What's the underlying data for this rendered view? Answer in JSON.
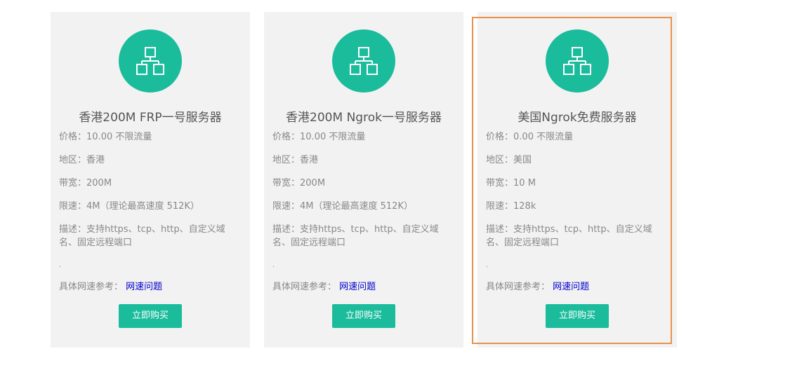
{
  "colors": {
    "accent": "#1abc9c",
    "highlight_border": "#e8914a",
    "card_bg": "#f2f2f2",
    "link": "#0000cc"
  },
  "icon": "network-topology-icon",
  "cards": [
    {
      "title": "香港200M FRP一号服务器",
      "price_label": "价格：",
      "price": "10.00 不限流量",
      "region_label": "地区：",
      "region": "香港",
      "bandwidth_label": "带宽：",
      "bandwidth": "200M",
      "speed_limit_label": "限速：",
      "speed_limit": "4M（理论最高速度 512K）",
      "description_label": "描述：",
      "description": "支持https、tcp、http、自定义域名、固定远程端口",
      "dot": "·",
      "reference_label": "具体网速参考：",
      "reference_link": "网速问题",
      "buy_label": "立即购买"
    },
    {
      "title": "香港200M Ngrok一号服务器",
      "price_label": "价格：",
      "price": "10.00 不限流量",
      "region_label": "地区：",
      "region": "香港",
      "bandwidth_label": "带宽：",
      "bandwidth": "200M",
      "speed_limit_label": "限速：",
      "speed_limit": "4M（理论最高速度 512K）",
      "description_label": "描述：",
      "description": "支持https、tcp、http、自定义域名、固定远程端口",
      "dot": "·",
      "reference_label": "具体网速参考：",
      "reference_link": "网速问题",
      "buy_label": "立即购买"
    },
    {
      "title": "美国Ngrok免费服务器",
      "price_label": "价格：",
      "price": "0.00 不限流量",
      "region_label": "地区：",
      "region": "美国",
      "bandwidth_label": "带宽：",
      "bandwidth": "10 M",
      "speed_limit_label": "限速：",
      "speed_limit": "128k",
      "description_label": "描述：",
      "description": "支持https、tcp、http、自定义域名、固定远程端口",
      "dot": "·",
      "reference_label": "具体网速参考：",
      "reference_link": "网速问题",
      "buy_label": "立即购买"
    }
  ]
}
